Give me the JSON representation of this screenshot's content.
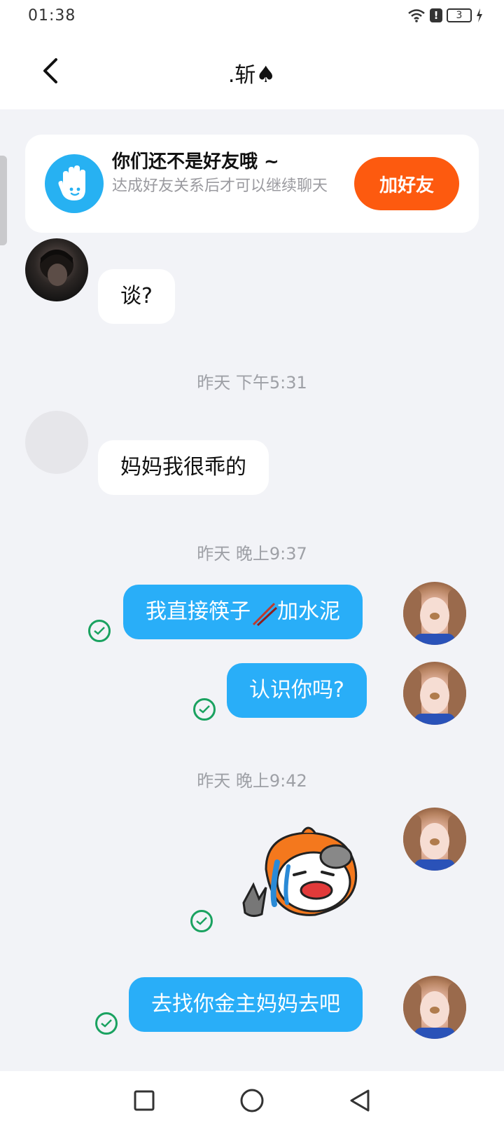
{
  "status_bar": {
    "time": "01:38",
    "battery": "3"
  },
  "header": {
    "title": ".斩",
    "title_suffix": "♠"
  },
  "friend_card": {
    "title": "你们还不是好友哦 ~",
    "subtitle": "达成好友关系后才可以继续聊天",
    "add_button": "加好友"
  },
  "messages": {
    "m1": "谈?",
    "t1": "昨天 下午5:31",
    "m2": "妈妈我很乖的",
    "t2": "昨天 晚上9:37",
    "m3_part1": "我直接筷子",
    "m3_part2": "加水泥",
    "m4": "认识你吗?",
    "t3": "昨天 晚上9:42",
    "m5": "去找你金主妈妈去吧"
  },
  "colors": {
    "accent_blue": "#29aef8",
    "add_button": "#fd5a0f",
    "check_green": "#1aa260"
  },
  "icons": {
    "back": "chevron-left-icon",
    "hand": "hand-wave-icon",
    "check": "check-circle-icon",
    "nav_recent": "square-icon",
    "nav_home": "circle-icon",
    "nav_back": "triangle-left-icon"
  }
}
